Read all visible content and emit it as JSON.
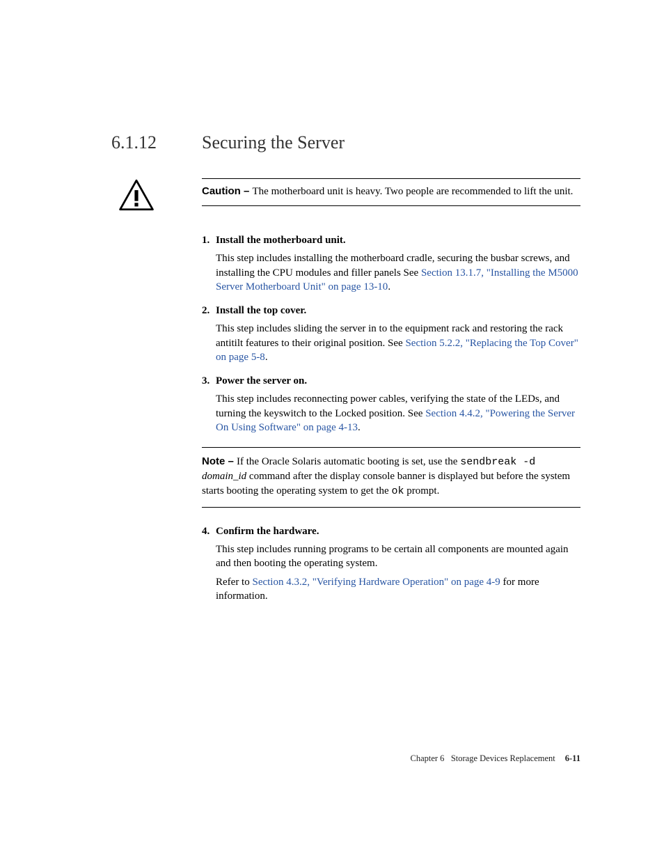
{
  "heading": {
    "number": "6.1.12",
    "title": "Securing the Server"
  },
  "caution": {
    "label": "Caution – ",
    "text": "The motherboard unit is heavy. Two people are recommended to lift the unit."
  },
  "steps": [
    {
      "title": "Install the motherboard unit.",
      "body_pre": "This step includes installing the motherboard cradle, securing the busbar screws, and installing the CPU modules and filler panels See ",
      "link": "Section 13.1.7, \"Installing the M5000 Server Motherboard Unit\" on page 13-10",
      "body_post": "."
    },
    {
      "title": "Install the top cover.",
      "body_pre": "This step includes sliding the server in to the equipment rack and restoring the rack antitilt features to their original position. See ",
      "link": "Section 5.2.2, \"Replacing the Top Cover\" on page 5-8",
      "body_post": "."
    },
    {
      "title": "Power the server on.",
      "body_pre": "This step includes reconnecting power cables, verifying the state of the LEDs, and turning the keyswitch to the Locked position. See ",
      "link": "Section 4.4.2, \"Powering the Server On Using Software\" on page 4-13",
      "body_post": "."
    }
  ],
  "note": {
    "label": "Note – ",
    "pre": "If the Oracle Solaris automatic booting is set, use the ",
    "code1": "sendbreak -d",
    "mid1": " ",
    "italic": "domain_id",
    "mid2": " command after the display console banner is displayed but before the system starts booting the operating system to get the ",
    "code2": "ok",
    "post": " prompt."
  },
  "step4": {
    "title": "Confirm the hardware.",
    "body1": "This step includes running programs to be certain all components are mounted again and then booting the operating system.",
    "body2_pre": "Refer to ",
    "body2_link": "Section 4.3.2, \"Verifying Hardware Operation\" on page 4-9",
    "body2_post": " for more information."
  },
  "footer": {
    "chapter": "Chapter 6",
    "title": "Storage Devices Replacement",
    "page": "6-11"
  }
}
